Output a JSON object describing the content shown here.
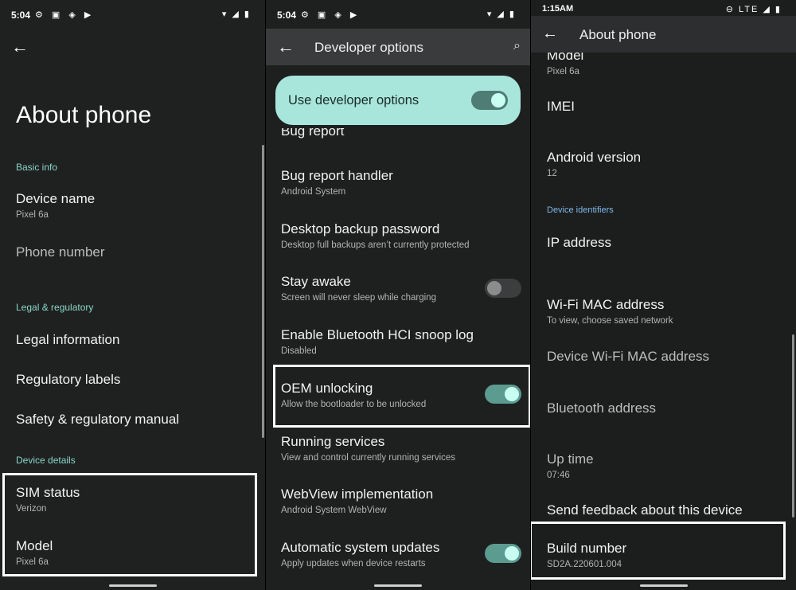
{
  "panel1": {
    "status": {
      "time": "5:04",
      "notifications": "⚙ ▣ ◈ ▶",
      "right": "▾ ◢ ▮"
    },
    "title": "About phone",
    "sections": {
      "basic": "Basic info",
      "legal": "Legal & regulatory",
      "details": "Device details"
    },
    "items": {
      "device_name": {
        "title": "Device name",
        "sub": "Pixel 6a"
      },
      "phone_number": {
        "title": "Phone number"
      },
      "legal_info": {
        "title": "Legal information"
      },
      "reg_labels": {
        "title": "Regulatory labels"
      },
      "safety": {
        "title": "Safety & regulatory manual"
      },
      "sim_status": {
        "title": "SIM status",
        "sub": "Verizon"
      },
      "model": {
        "title": "Model",
        "sub": "Pixel 6a"
      }
    }
  },
  "panel2": {
    "status": {
      "time": "5:04",
      "notifications": "⚙ ▣ ◈ ▶",
      "right": "▾ ◢ ▮"
    },
    "title": "Developer options",
    "master_label": "Use developer options",
    "master_on": true,
    "items": {
      "bug_report": {
        "title": "Bug report"
      },
      "bug_handler": {
        "title": "Bug report handler",
        "sub": "Android System"
      },
      "backup_pw": {
        "title": "Desktop backup password",
        "sub": "Desktop full backups aren’t currently protected"
      },
      "stay_awake": {
        "title": "Stay awake",
        "sub": "Screen will never sleep while charging",
        "on": false
      },
      "hci_snoop": {
        "title": "Enable Bluetooth HCI snoop log",
        "sub": "Disabled"
      },
      "oem": {
        "title": "OEM unlocking",
        "sub": "Allow the bootloader to be unlocked",
        "on": true
      },
      "running": {
        "title": "Running services",
        "sub": "View and control currently running services"
      },
      "webview": {
        "title": "WebView implementation",
        "sub": "Android System WebView"
      },
      "auto_updates": {
        "title": "Automatic system updates",
        "sub": "Apply updates when device restarts",
        "on": true
      }
    }
  },
  "panel3": {
    "status": {
      "time": "1:15AM",
      "right": "⊖ LTE ◢ ▮"
    },
    "title": "About phone",
    "section_identifiers": "Device identifiers",
    "items": {
      "model": {
        "title": "Model",
        "sub": "Pixel 6a"
      },
      "imei": {
        "title": "IMEI",
        "sub": ""
      },
      "android": {
        "title": "Android version",
        "sub": "12"
      },
      "ip": {
        "title": "IP address",
        "sub": ""
      },
      "wifi_mac": {
        "title": "Wi-Fi MAC address",
        "sub": "To view, choose saved network"
      },
      "dev_wifi_mac": {
        "title": "Device Wi-Fi MAC address",
        "sub": ""
      },
      "bt": {
        "title": "Bluetooth address",
        "sub": ""
      },
      "uptime": {
        "title": "Up time",
        "sub": "07:46"
      },
      "feedback": {
        "title": "Send feedback about this device"
      },
      "build": {
        "title": "Build number",
        "sub": "SD2A.220601.004"
      }
    }
  },
  "icons": {
    "back": "←",
    "search": "⌕"
  }
}
